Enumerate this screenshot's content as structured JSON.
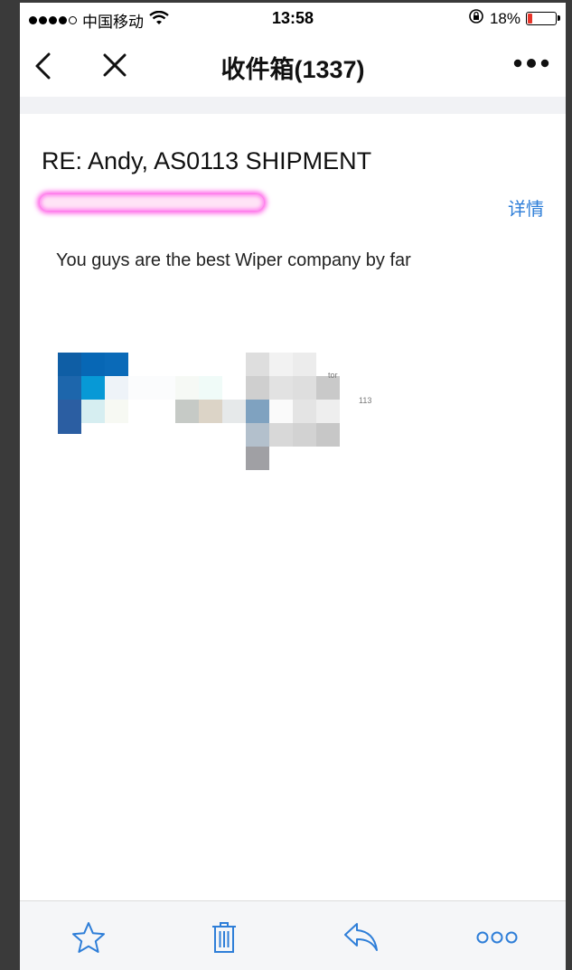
{
  "status_bar": {
    "carrier": "中国移动",
    "time": "13:58",
    "battery_percent": "18%",
    "battery_level": 0.18
  },
  "nav": {
    "title": "收件箱(1337)",
    "back_icon": "chevron-left-icon",
    "close_icon": "close-icon",
    "more_icon": "more-dots-icon"
  },
  "mail": {
    "subject": "RE: Andy, AS0113 SHIPMENT",
    "sender_redacted": "",
    "detail_link": "详情",
    "body": "You guys are the best Wiper company by far",
    "signature_text_1": "tor",
    "signature_text_2": "113"
  },
  "toolbar": {
    "star_icon": "star-icon",
    "trash_icon": "trash-icon",
    "reply_icon": "reply-icon",
    "more_icon": "more-circles-icon"
  },
  "colors": {
    "accent": "#2e7ed8",
    "battery_low": "#e8352a",
    "highlight": "#ff5ce6"
  }
}
